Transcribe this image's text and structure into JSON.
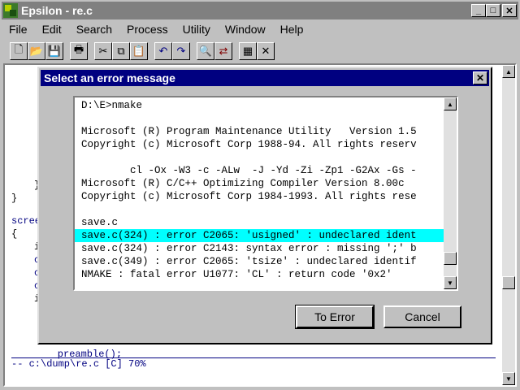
{
  "window": {
    "title": "Epsilon - re.c"
  },
  "caption_buttons": {
    "minimize": "_",
    "maximize": "□",
    "close": "✕"
  },
  "menu": [
    "File",
    "Edit",
    "Search",
    "Process",
    "Utility",
    "Window",
    "Help"
  ],
  "toolbar": {
    "icons": [
      "new-file-icon",
      "open-folder-icon",
      "save-disk-icon",
      "print-icon",
      "cut-icon",
      "copy-icon",
      "paste-icon",
      "undo-icon",
      "redo-icon",
      "find-icon",
      "replace-icon",
      "calculator-icon",
      "close-buffer-icon"
    ]
  },
  "editor": {
    "lines": [
      "}",
      "}",
      "scree",
      "{",
      "i",
      "c",
      "c",
      "c",
      "i"
    ],
    "bottom_line": "    preamble();",
    "status": "-- c:\\dump\\re.c [C] 70% "
  },
  "dialog": {
    "title": "Select an error message",
    "close_label": "✕",
    "lines": [
      "D:\\E>nmake",
      "",
      "Microsoft (R) Program Maintenance Utility   Version 1.5",
      "Copyright (c) Microsoft Corp 1988-94. All rights reserv",
      "",
      "        cl -Ox -W3 -c -ALw  -J -Yd -Zi -Zp1 -G2Ax -Gs -",
      "Microsoft (R) C/C++ Optimizing Compiler Version 8.00c",
      "Copyright (c) Microsoft Corp 1984-1993. All rights rese",
      "",
      "save.c",
      "save.c(324) : error C2065: 'usigned' : undeclared ident",
      "save.c(324) : error C2143: syntax error : missing ';' b",
      "save.c(349) : error C2065: 'tsize' : undeclared identif",
      "NMAKE : fatal error U1077: 'CL' : return code '0x2'"
    ],
    "selected_index": 10,
    "buttons": {
      "to_error": "To Error",
      "cancel": "Cancel"
    }
  }
}
